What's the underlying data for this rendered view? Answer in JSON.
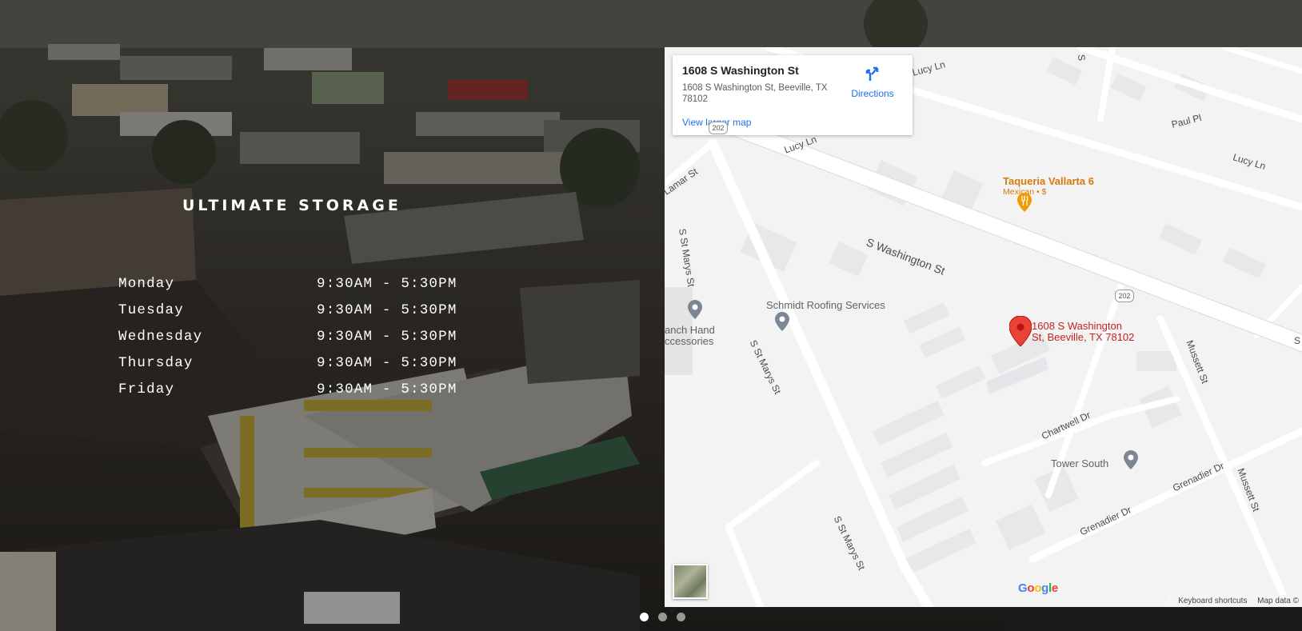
{
  "brand": {
    "name": "ULTIMATE STORAGE"
  },
  "hours": [
    {
      "day": "Monday",
      "time": "9:30AM - 5:30PM"
    },
    {
      "day": "Tuesday",
      "time": "9:30AM - 5:30PM"
    },
    {
      "day": "Wednesday",
      "time": "9:30AM - 5:30PM"
    },
    {
      "day": "Thursday",
      "time": "9:30AM - 5:30PM"
    },
    {
      "day": "Friday",
      "time": "9:30AM - 5:30PM"
    }
  ],
  "map": {
    "card": {
      "title": "1608 S Washington St",
      "address": "1608 S Washington St, Beeville, TX 78102",
      "directions": "Directions",
      "view_larger": "View larger map"
    },
    "pin_label_line1": "1608 S Washington",
    "pin_label_line2": "St, Beeville, TX 78102",
    "streets": {
      "washington": "S Washington St",
      "st_marys": "S St Marys St",
      "lucy_1": "Lucy Ln",
      "lucy_2": "Lucy Ln",
      "lucy_3": "Lucy Ln",
      "paul": "Paul Pl",
      "lamar": "Lamar St",
      "mussett_1": "Mussett St",
      "mussett_2": "Mussett St",
      "chartwell": "Chartwell Dr",
      "grenadier_1": "Grenadier Dr",
      "grenadier_2": "Grenadier Dr",
      "st_marys_2": "S St Marys St",
      "st_marys_3": "S St Marys St",
      "s_edge": "S",
      "s_edge_2": "S"
    },
    "route_shield": "202",
    "route_shield_2": "202",
    "pois": {
      "taqueria_name": "Taqueria Vallarta 6",
      "taqueria_sub": "Mexican • $",
      "schmidt": "Schmidt Roofing Services",
      "ranch_1": "anch Hand",
      "ranch_2": "ccessories",
      "tower": "Tower South"
    },
    "google_logo": [
      "G",
      "o",
      "o",
      "g",
      "l",
      "e"
    ],
    "google_colors": [
      "#4285F4",
      "#EA4335",
      "#FBBC05",
      "#4285F4",
      "#34A853",
      "#EA4335"
    ],
    "footer": {
      "shortcuts": "Keyboard shortcuts",
      "data": "Map data ©"
    }
  },
  "slider": {
    "count": 3,
    "active": 1
  }
}
